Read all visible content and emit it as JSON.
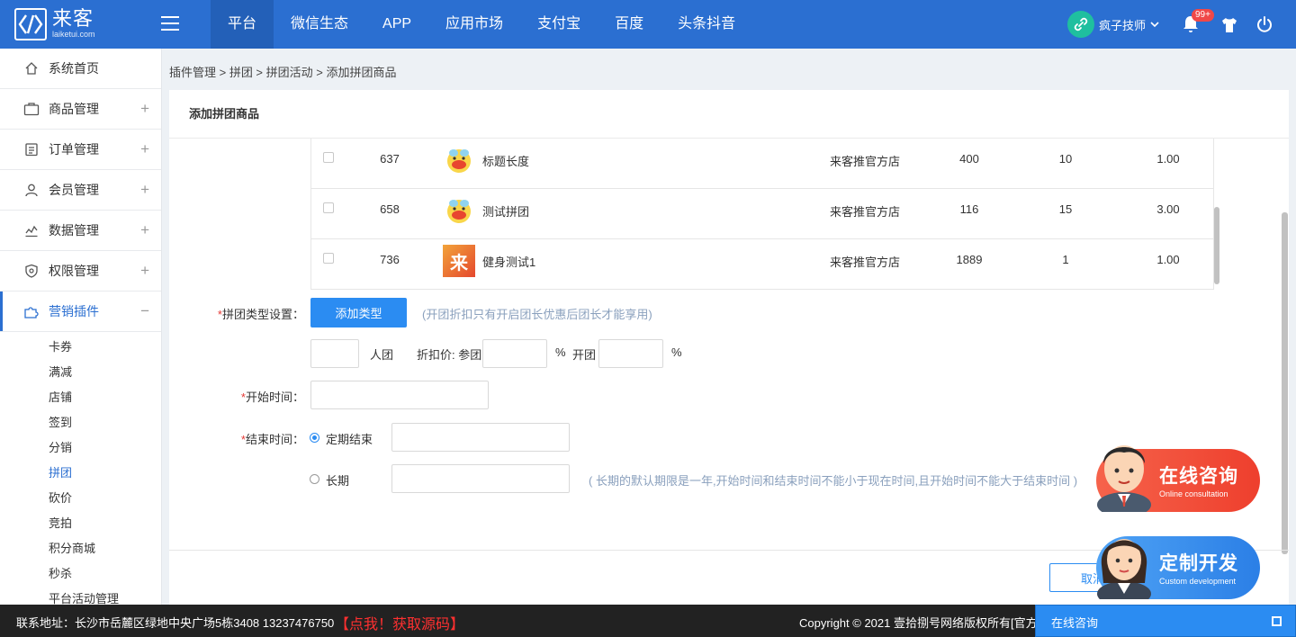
{
  "app": {
    "logo_cn": "来客",
    "logo_en": "laiketui.com"
  },
  "nav": [
    {
      "label": "平台",
      "active": true
    },
    {
      "label": "微信生态"
    },
    {
      "label": "APP"
    },
    {
      "label": "应用市场"
    },
    {
      "label": "支付宝"
    },
    {
      "label": "百度"
    },
    {
      "label": "头条抖音"
    }
  ],
  "user": {
    "name": "疯子技师",
    "badge": "99+"
  },
  "sidebar": {
    "items": [
      {
        "label": "系统首页",
        "icon": "home-icon"
      },
      {
        "label": "商品管理",
        "icon": "bag-icon",
        "toggle": "+"
      },
      {
        "label": "订单管理",
        "icon": "order-icon",
        "toggle": "+"
      },
      {
        "label": "会员管理",
        "icon": "member-icon",
        "toggle": "+"
      },
      {
        "label": "数据管理",
        "icon": "chart-icon",
        "toggle": "+"
      },
      {
        "label": "权限管理",
        "icon": "shield-icon",
        "toggle": "+"
      },
      {
        "label": "营销插件",
        "icon": "puzzle-icon",
        "toggle": "−",
        "active": true
      }
    ],
    "subitems": [
      "卡券",
      "满减",
      "店铺",
      "签到",
      "分销",
      "拼团",
      "砍价",
      "竞拍",
      "积分商城",
      "秒杀",
      "平台活动管理"
    ],
    "active_sub": "拼团"
  },
  "breadcrumb": "插件管理 > 拼团 > 拼团活动 > 添加拼团商品",
  "card": {
    "title": "添加拼团商品"
  },
  "products": [
    {
      "id": "637",
      "name": "标题长度",
      "shop": "来客推官方店",
      "price": "400",
      "stock": "10",
      "weight": "1.00",
      "thumb": "duck"
    },
    {
      "id": "658",
      "name": "测试拼团",
      "shop": "来客推官方店",
      "price": "116",
      "stock": "15",
      "weight": "3.00",
      "thumb": "duck"
    },
    {
      "id": "736",
      "name": "健身测试1",
      "shop": "来客推官方店",
      "price": "1889",
      "stock": "1",
      "weight": "1.00",
      "thumb": "lai",
      "thumb_text": "来"
    }
  ],
  "form": {
    "type_label": "拼团类型设置：",
    "add_type_button": "添加类型",
    "type_hint": "(开团折扣只有开启团长优惠后团长才能享用)",
    "group_unit": "人团",
    "discount_label": "折扣价: 参团",
    "percent": "%",
    "leader_label": "开团",
    "start_label": "开始时间：",
    "end_label": "结束时间：",
    "end_fixed": "定期结束",
    "end_long": "长期",
    "long_hint": "( 长期的默认期限是一年,开始时间和结束时间不能小于现在时间,且开始时间不能大于结束时间 )",
    "required_mark": "*",
    "cancel_button": "取消"
  },
  "promo": {
    "consult_title": "在线咨询",
    "consult_sub": "Online consultation",
    "custom_title": "定制开发",
    "custom_sub": "Custom development"
  },
  "footer": {
    "address": "联系地址：长沙市岳麓区绿地中央广场5栋3408 13237476750",
    "link": "【点我！获取源码】",
    "copyright": "Copyright © 2021 壹拾捌号网络版权所有[官方"
  },
  "chat": {
    "label": "在线咨询"
  },
  "colors": {
    "primary": "#2b6fd1",
    "button": "#2b8cf2",
    "required": "#e53935",
    "footer_link": "#ff3030"
  }
}
